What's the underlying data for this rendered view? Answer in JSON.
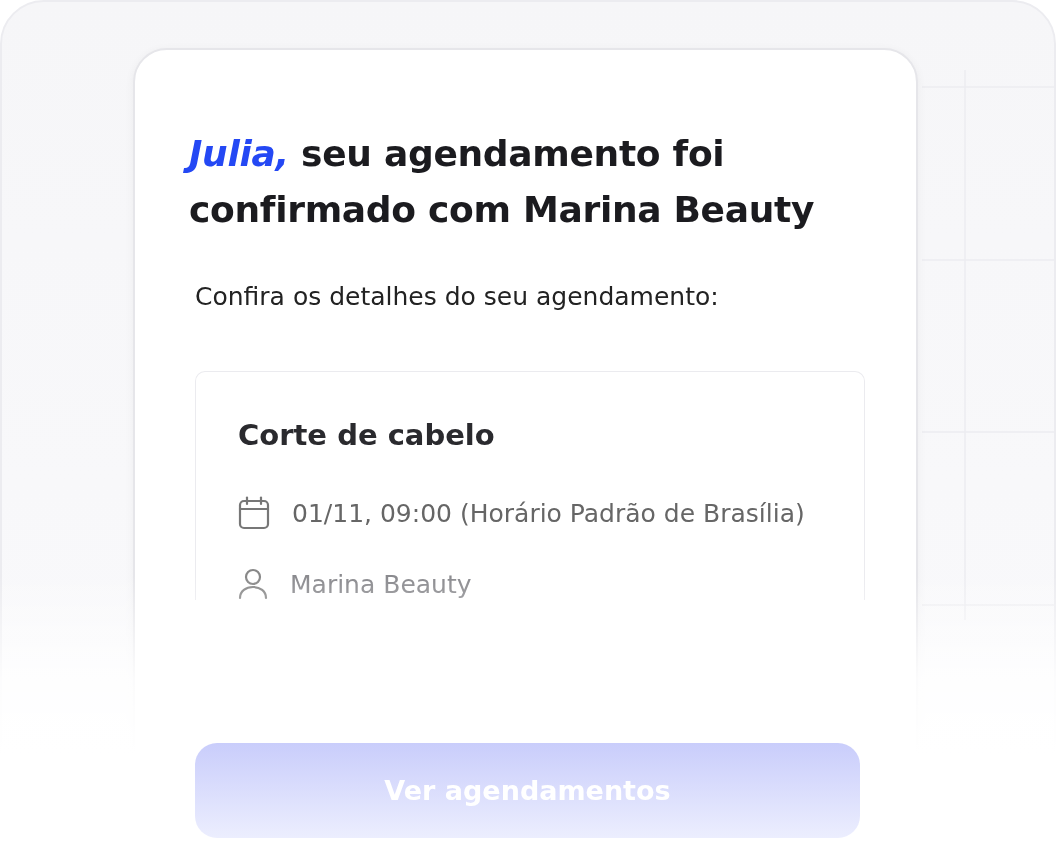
{
  "heading": {
    "name": "Julia,",
    "text": "seu agendamento foi confirmado com Marina Beauty"
  },
  "intro": "Confira os detalhes do seu agendamento:",
  "appointment": {
    "service": "Corte de cabelo",
    "details": [
      {
        "kind": "date",
        "text": "01/11, 09:00 (Horário Padrão de Brasília)"
      },
      {
        "kind": "person",
        "text": "Marina Beauty"
      }
    ]
  },
  "button": "Ver agendamentos"
}
